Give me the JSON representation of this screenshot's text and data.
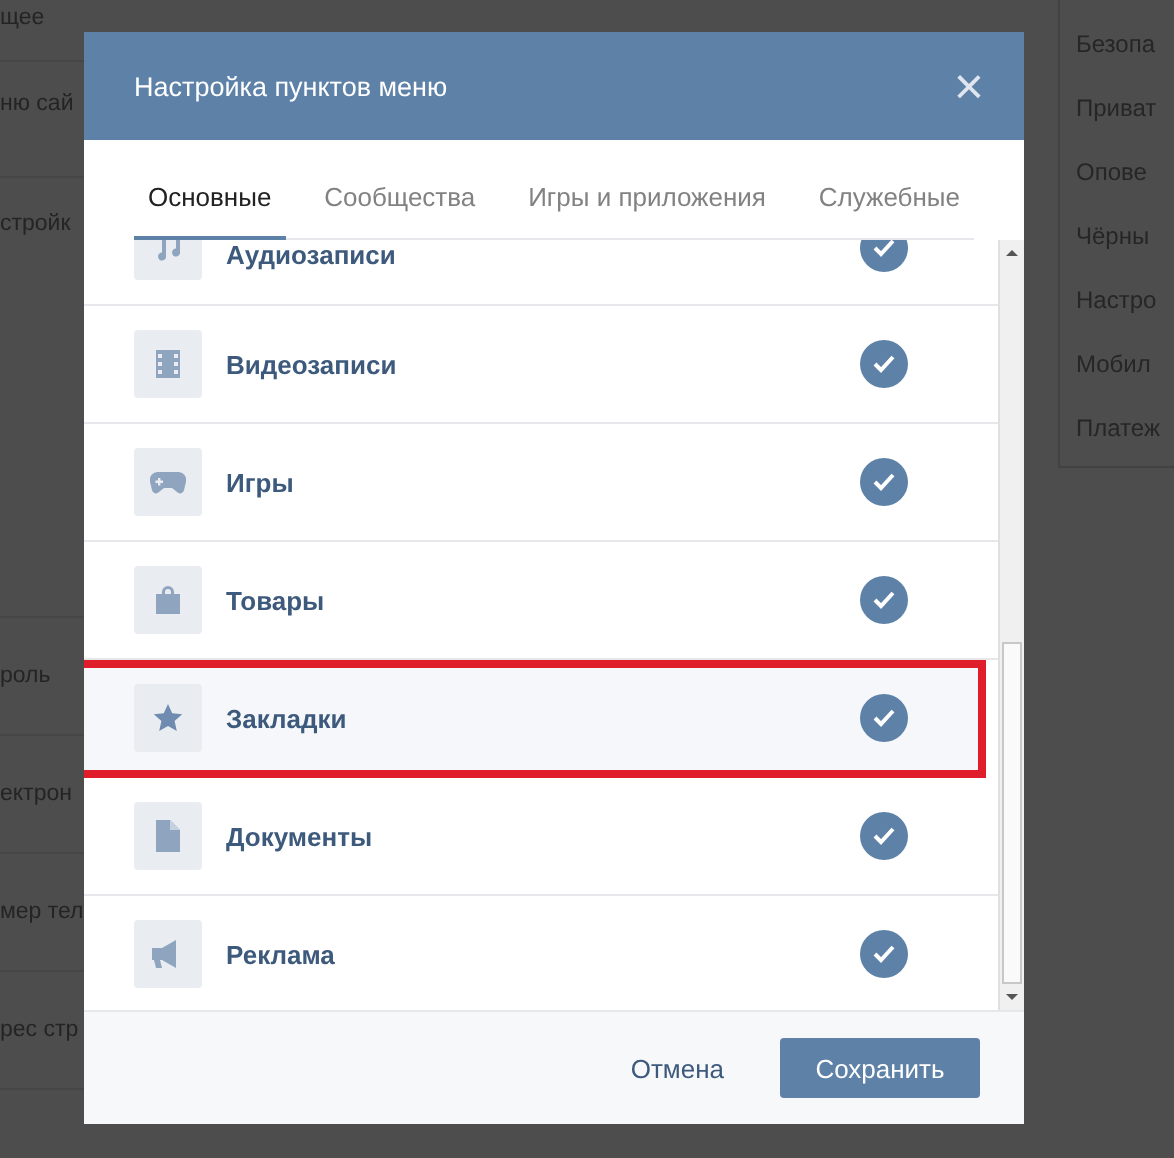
{
  "background_page": {
    "left_column": [
      "щее",
      "ню сай",
      "стройк",
      "роль",
      "ектрон",
      "мер тел",
      "рес стр"
    ],
    "right_menu": [
      "Безопа",
      "Приват",
      "Опове",
      "Чёрны",
      "Настро",
      "Мобил",
      "Платеж"
    ]
  },
  "dialog": {
    "title": "Настройка пунктов меню",
    "close": "×",
    "tabs": [
      {
        "label": "Основные",
        "selected": true
      },
      {
        "label": "Сообщества",
        "selected": false
      },
      {
        "label": "Игры и приложения",
        "selected": false
      },
      {
        "label": "Служебные",
        "selected": false
      }
    ],
    "items": [
      {
        "label": "Аудиозаписи",
        "kind": "music",
        "checked": true,
        "highlighted": false
      },
      {
        "label": "Видеозаписи",
        "kind": "film",
        "checked": true,
        "highlighted": false
      },
      {
        "label": "Игры",
        "kind": "gamepad",
        "checked": true,
        "highlighted": false
      },
      {
        "label": "Товары",
        "kind": "bag",
        "checked": true,
        "highlighted": false
      },
      {
        "label": "Закладки",
        "kind": "star",
        "checked": true,
        "highlighted": true
      },
      {
        "label": "Документы",
        "kind": "document",
        "checked": true,
        "highlighted": false
      },
      {
        "label": "Реклама",
        "kind": "megaphone",
        "checked": true,
        "highlighted": false
      }
    ],
    "buttons": {
      "cancel": "Отмена",
      "save": "Сохранить"
    }
  }
}
